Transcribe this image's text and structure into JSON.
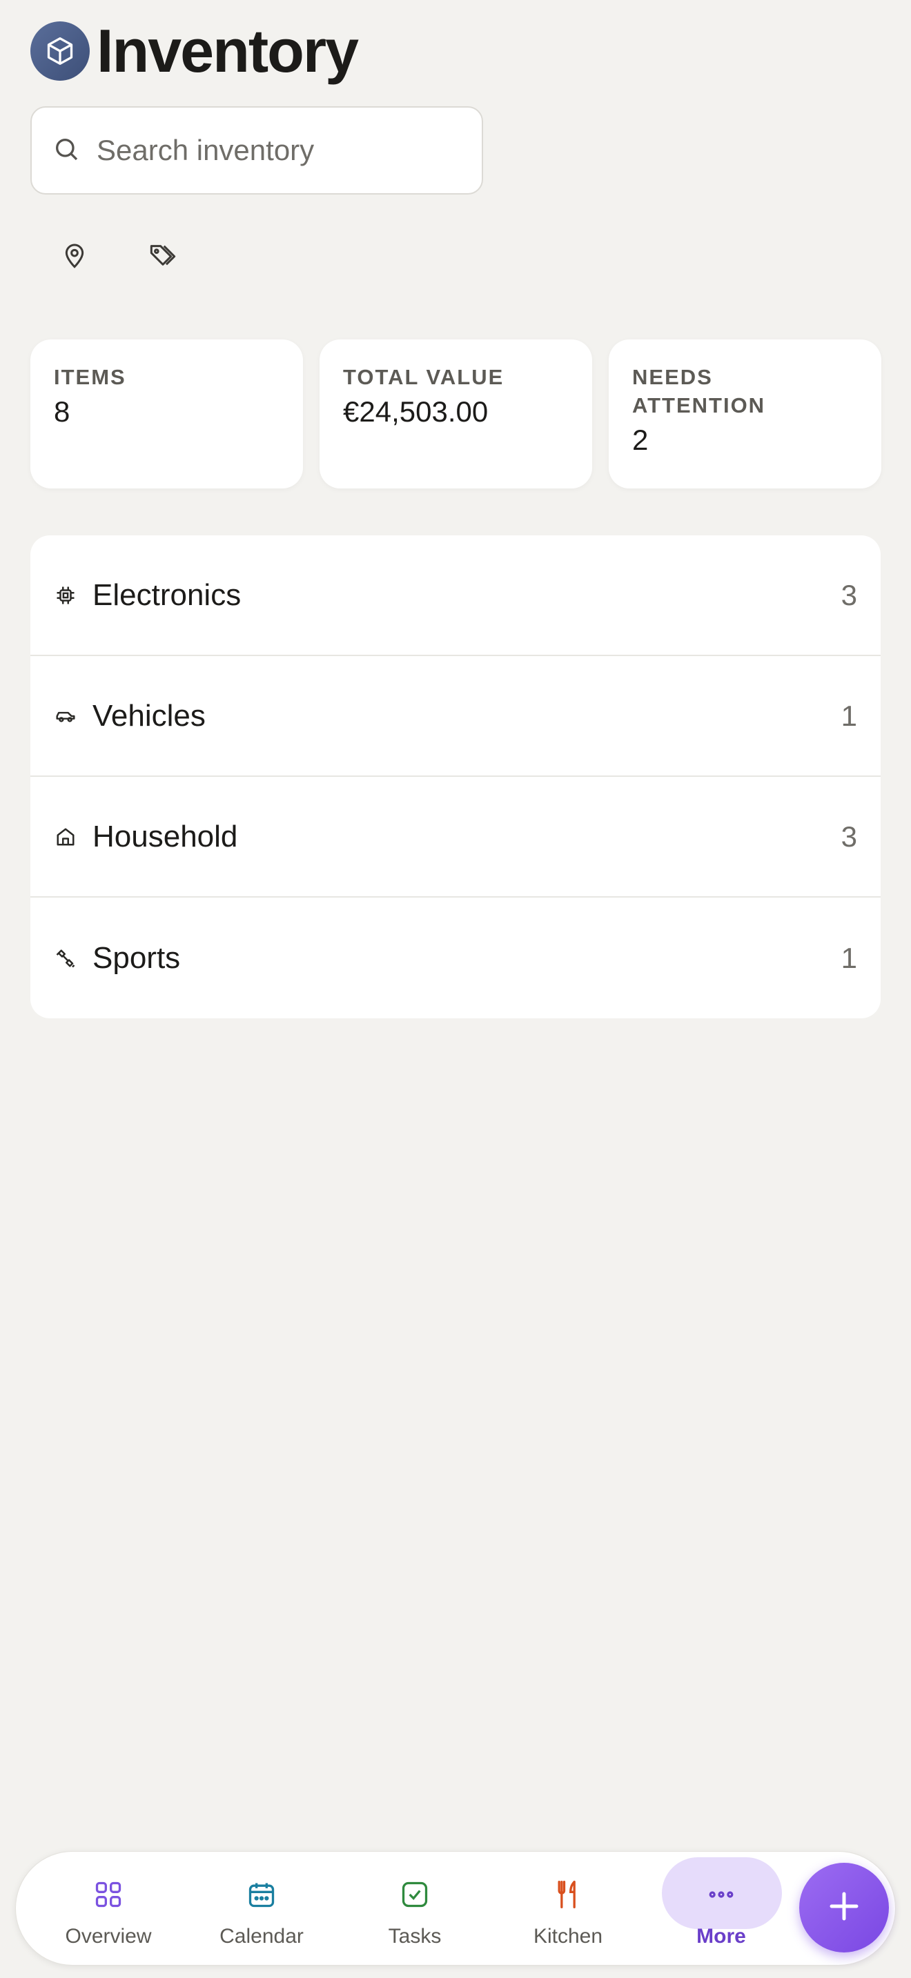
{
  "header": {
    "title": "Inventory",
    "logo_icon": "cube-icon"
  },
  "search": {
    "placeholder": "Search inventory",
    "value": ""
  },
  "filters": [
    {
      "icon": "location-pin-icon"
    },
    {
      "icon": "tags-icon"
    }
  ],
  "stats": [
    {
      "label": "ITEMS",
      "value": "8"
    },
    {
      "label": "TOTAL VALUE",
      "value": "€24,503.00"
    },
    {
      "label": "NEEDS ATTENTION",
      "value": "2"
    }
  ],
  "categories": [
    {
      "label": "Electronics",
      "count": "3",
      "icon": "chip-icon"
    },
    {
      "label": "Vehicles",
      "count": "1",
      "icon": "car-icon"
    },
    {
      "label": "Household",
      "count": "3",
      "icon": "house-icon"
    },
    {
      "label": "Sports",
      "count": "1",
      "icon": "dumbbell-icon"
    }
  ],
  "nav": {
    "items": [
      {
        "label": "Overview",
        "icon": "grid-icon",
        "color": "#7b52e0"
      },
      {
        "label": "Calendar",
        "icon": "calendar-icon",
        "color": "#1a7fa0"
      },
      {
        "label": "Tasks",
        "icon": "check-square-icon",
        "color": "#2f8a3e"
      },
      {
        "label": "Kitchen",
        "icon": "utensils-icon",
        "color": "#d9501e"
      },
      {
        "label": "More",
        "icon": "more-dots-icon",
        "color": "#6a3fc9",
        "active": true
      }
    ],
    "fab_icon": "plus-icon"
  },
  "colors": {
    "accent": "#7a47e3",
    "background": "#f3f2ef"
  }
}
